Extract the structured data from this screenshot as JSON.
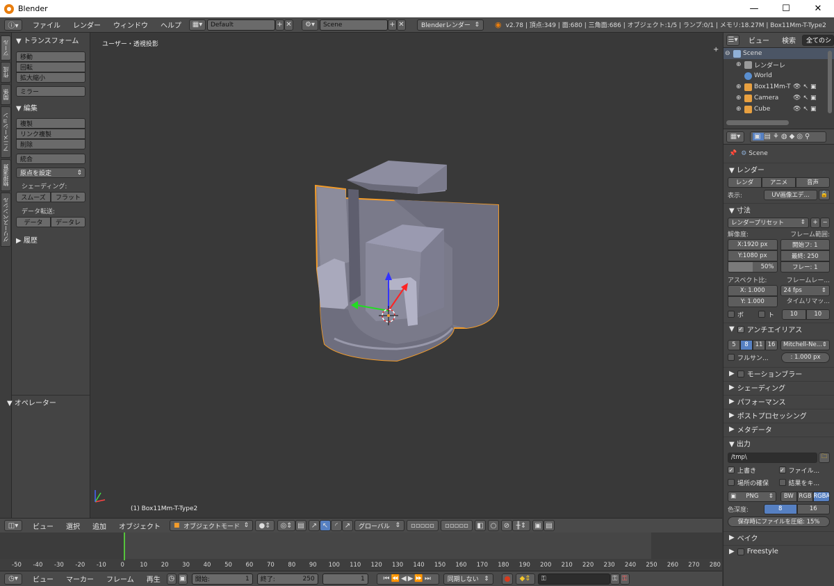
{
  "window": {
    "title": "Blender",
    "minimize": "—",
    "maximize": "☐",
    "close": "✕"
  },
  "topbar": {
    "menus": [
      "ファイル",
      "レンダー",
      "ウィンドウ",
      "ヘルプ"
    ],
    "screen_layout": "Default",
    "scene": "Scene",
    "engine": "Blenderレンダー",
    "stats": "v2.78 | 頂点:349 | 面:680 | 三角面:686 | オブジェクト:1/5 | ランプ:0/1 | メモリ:18.27M | Box11Mm-T-Type2"
  },
  "tabs": [
    "ツール",
    "作成",
    "関係",
    "アニメーション",
    "物理演算",
    "グリースペンシル"
  ],
  "toolshelf": {
    "transform_header": "▼ トランスフォーム",
    "transform_buttons": [
      "移動",
      "回転",
      "拡大縮小"
    ],
    "mirror": "ミラー",
    "edit_header": "▼ 編集",
    "edit_buttons": [
      "複製",
      "リンク複製",
      "削除"
    ],
    "join": "統合",
    "set_origin": "原点を設定",
    "shading_label": "シェーディング:",
    "smooth": "スムーズ",
    "flat": "フラット",
    "data_transfer_label": "データ転送:",
    "data": "データ",
    "data_layout": "データレ",
    "history_header": "▶ 履歴",
    "operator_header": "▼ オペレーター"
  },
  "viewport": {
    "view_label": "ユーザー・透視投影",
    "object_label": "(1) Box11Mm-T-Type2"
  },
  "viewport_header": {
    "menus": [
      "ビュー",
      "選択",
      "追加",
      "オブジェクト"
    ],
    "mode": "オブジェクトモード",
    "orientation": "グローバル"
  },
  "timeline": {
    "ticks": [
      "-50",
      "-40",
      "-30",
      "-20",
      "-10",
      "0",
      "10",
      "20",
      "30",
      "40",
      "50",
      "60",
      "70",
      "80",
      "90",
      "100",
      "110",
      "120",
      "130",
      "140",
      "150",
      "160",
      "170",
      "180",
      "190",
      "200",
      "210",
      "220",
      "230",
      "240",
      "250",
      "260",
      "270",
      "280"
    ],
    "current_frame": 1,
    "range_start": 0,
    "range_end": 250
  },
  "timeline_header": {
    "menus": [
      "ビュー",
      "マーカー",
      "フレーム",
      "再生"
    ],
    "start_label": "開始:",
    "start_value": "1",
    "end_label": "終了:",
    "end_value": "250",
    "current": "1",
    "sync": "同期しない"
  },
  "outliner": {
    "view": "ビュー",
    "search": "検索",
    "filter": "全てのシ",
    "items": [
      {
        "name": "Scene",
        "color": "#8fb0d8"
      },
      {
        "name": "レンダーレ",
        "color": "#9a9a9a"
      },
      {
        "name": "World",
        "color": "#5a8fd0"
      },
      {
        "name": "Box11Mm-T",
        "color": "#e8a040"
      },
      {
        "name": "Camera",
        "color": "#e8a040"
      },
      {
        "name": "Cube",
        "color": "#e8a040"
      }
    ]
  },
  "properties": {
    "scene": "Scene",
    "render_header": "▼ レンダー",
    "render_btn": "レンダ",
    "anim_btn": "アニメ",
    "sound_btn": "音声",
    "display_label": "表示:",
    "display_value": "UV画像エデ...",
    "dimensions_header": "▼ 寸法",
    "render_presets": "レンダープリセット",
    "resolution_label": "解像度:",
    "frame_range_label": "フレーム範囲:",
    "res_x": "X:1920 px",
    "res_y": "Y:1080 px",
    "res_pct": "50%",
    "frame_start": "開始フ: 1",
    "frame_end": "最終: 250",
    "frame_step": "フレー: 1",
    "aspect_label": "アスペクト比:",
    "framerate_label": "フレームレー...",
    "aspect_x": "X: 1.000",
    "aspect_y": "Y: 1.000",
    "fps": "24 fps",
    "time_remap_label": "タイムリマッ...",
    "border": "ボ",
    "crop": "ト",
    "remap_old": "10",
    "remap_new": "10",
    "aa_header": "アンチエイリアス",
    "aa_samples": [
      "5",
      "8",
      "11",
      "16"
    ],
    "aa_filter": "Mitchell-Ne...",
    "full_sample": "フルサン...",
    "aa_size": ": 1.000 px",
    "motion_blur": "モーションブラー",
    "shading": "シェーディング",
    "performance": "パフォーマンス",
    "post_processing": "ポストプロセッシング",
    "metadata": "メタデータ",
    "output_header": "▼ 出力",
    "output_path": "/tmp\\",
    "overwrite": "上書き",
    "file_ext": "ファイル...",
    "placeholders": "場所の確保",
    "cache_result": "結果をキ...",
    "format": "PNG",
    "bw": "BW",
    "rgb": "RGB",
    "rgba": "RGBA",
    "color_depth_label": "色深度:",
    "depth_8": "8",
    "depth_16": "16",
    "compression": "保存時にファイルを圧縮: 15%",
    "bake": "ベイク",
    "freestyle": "Freestyle"
  }
}
